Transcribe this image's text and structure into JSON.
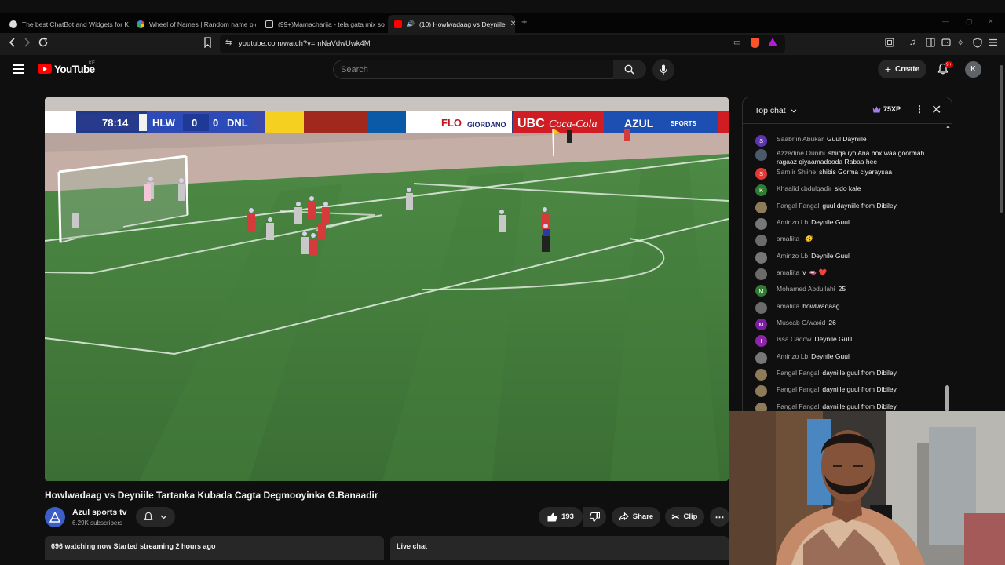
{
  "browser": {
    "tabs": [
      {
        "title": "The best ChatBot and Widgets for Ki"
      },
      {
        "title": "Wheel of Names | Random name pic"
      },
      {
        "title": "(99+)Mamacharija - tela gata mix so"
      },
      {
        "title": "(10) Howlwadaag vs Deyniile"
      }
    ],
    "url": "youtube.com/watch?v=mNaVdwUwk4M"
  },
  "youtube": {
    "logo_text": "YouTube",
    "country_code": "KE",
    "search_placeholder": "Search",
    "create_label": "Create",
    "notifications_badge": "9+",
    "avatar_letter": "K",
    "brand_red": "#ff0000"
  },
  "video": {
    "scoreboard": {
      "clock": "78:14",
      "home": "HLW",
      "home_score": "0",
      "away_score": "0",
      "away": "DNL"
    },
    "ad_boards": [
      "FLO",
      "GIORDANO",
      "UBC",
      "Coca-Cola",
      "AZUL",
      "SPORTS"
    ],
    "title": "Howlwadaag vs Deyniile Tartanka Kubada Cagta Degmooyinka G.Banaadir",
    "channel_name": "Azul sports tv",
    "subscribers": "6.29K subscribers",
    "likes": "193",
    "share_label": "Share",
    "clip_label": "Clip",
    "watching": "696 watching now  Started streaming 2 hours ago",
    "live_chat_label": "Live chat"
  },
  "chat": {
    "mode_label": "Top chat",
    "xp_label": "75XP",
    "messages": [
      {
        "author": "Saabriin Abukar",
        "text": "Guul Dayniile",
        "avatar": "S",
        "color": "#5e35b1"
      },
      {
        "author": "Azzedine Ounihi",
        "text": "shiiqa iyo Ana box waa goormah ragaaz qiyaamadooda Rabaa hee",
        "avatar": "",
        "color": "#4a5a6a"
      },
      {
        "author": "Samiir Shiine",
        "text": "shibis Gorma ciyaraysaa",
        "avatar": "S",
        "color": "#e53935"
      },
      {
        "author": "Khaalid cbdulqadir",
        "text": "sido kale",
        "avatar": "K",
        "color": "#2e7d32"
      },
      {
        "author": "Fangal Fangal",
        "text": "guul dayniile from Dibiley",
        "avatar": "",
        "color": "#8d7b5a"
      },
      {
        "author": "Aminzo Lb",
        "text": "Deynile Guul",
        "avatar": "",
        "color": "#777777"
      },
      {
        "author": "amaliita",
        "text": "",
        "emoji": "🫨",
        "avatar": "",
        "color": "#6b6b6b"
      },
      {
        "author": "Aminzo Lb",
        "text": "Deynile Guul",
        "avatar": "",
        "color": "#777777"
      },
      {
        "author": "amaliita",
        "text": "v",
        "emoji": "🫦 ❤️",
        "avatar": "",
        "color": "#6b6b6b"
      },
      {
        "author": "Mohamed Abdullahi",
        "text": "25",
        "avatar": "M",
        "color": "#2e7d32"
      },
      {
        "author": "amaliita",
        "text": "howlwadaag",
        "avatar": "",
        "color": "#6b6b6b"
      },
      {
        "author": "Muscab C/waxid",
        "text": "26",
        "avatar": "M",
        "color": "#7b1fa2"
      },
      {
        "author": "Issa Cadow",
        "text": "Deynile Gulll",
        "avatar": "I",
        "color": "#8e24aa"
      },
      {
        "author": "Aminzo Lb",
        "text": "Deynile Guul",
        "avatar": "",
        "color": "#777777"
      },
      {
        "author": "Fangal Fangal",
        "text": "dayniile guul from Dibiley",
        "avatar": "",
        "color": "#8d7b5a"
      },
      {
        "author": "Fangal Fangal",
        "text": "dayniile guul from Dibiley",
        "avatar": "",
        "color": "#8d7b5a"
      },
      {
        "author": "Fangal Fangal",
        "text": "dayniile guul from Dibiley",
        "avatar": "",
        "color": "#8d7b5a"
      }
    ]
  }
}
